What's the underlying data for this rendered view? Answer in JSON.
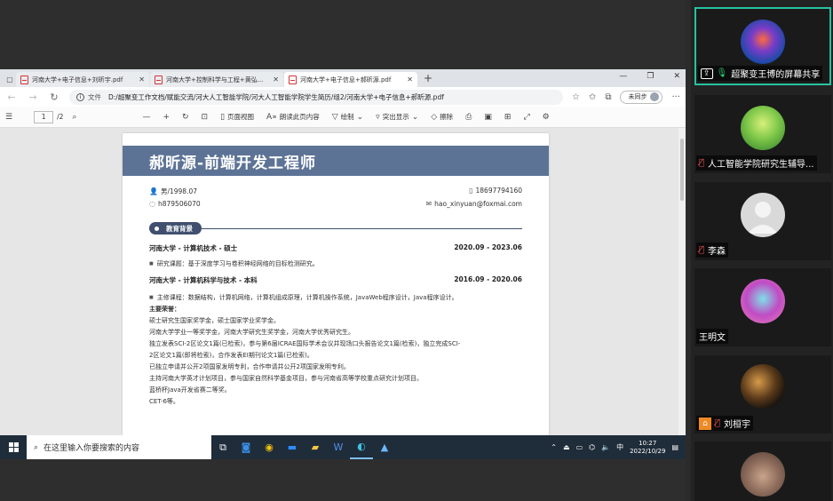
{
  "browser": {
    "tabs": [
      {
        "title": "河南大学+电子信息+刘昕宇.pdf"
      },
      {
        "title": "河南大学+控制科学与工程+黄弘..."
      },
      {
        "title": "河南大学+电子信息+郝昕源.pdf"
      }
    ],
    "new_tab_glyph": "+",
    "address": {
      "label": "文件",
      "path": "D:/超聚变工作文档/赋能交流/河大人工智能学院/河大人工智能学院学生简历/组2/河南大学+电子信息+郝昕源.pdf"
    },
    "sync_label": "未同步"
  },
  "pdf_toolbar": {
    "page_current": "1",
    "page_total": "/2",
    "items": [
      {
        "icon": "page-view-icon",
        "label": "页面视图"
      },
      {
        "icon": "read-aloud-icon",
        "label": "朗读此页内容"
      },
      {
        "icon": "draw-icon",
        "label": "绘制"
      },
      {
        "icon": "highlight-icon",
        "label": "突出显示"
      },
      {
        "icon": "erase-icon",
        "label": "擦除"
      }
    ]
  },
  "resume": {
    "title": "郝昕源-前端开发工程师",
    "gender_birth": "男/1998.07",
    "wechat": "h879506070",
    "phone": "18697794160",
    "email": "hao_xinyuan@foxmai.com",
    "section_education": "教育背景",
    "edu1_school": "河南大学 - 计算机技术 - 硕士",
    "edu1_date": "2020.09 - 2023.06",
    "edu1_topic": "研究课题：基于深度学习与卷积神经网络的目标检测研究。",
    "edu2_school": "河南大学 - 计算机科学与技术 - 本科",
    "edu2_date": "2016.09 - 2020.06",
    "edu2_courses": "主修课程：数据结构，计算机网络，计算机组成原理，计算机操作系统，JavaWeb程序设计，Java程序设计。",
    "honors_title": "主要荣誉：",
    "honors": [
      "硕士研究生国家奖学金，硕士国家学业奖学金。",
      "河南大学学业一等奖学金，河南大学研究生奖学金，河南大学优秀研究生。",
      "独立发表SCI-2区论文1篇(已检索)，参与第6届ICRAE国际学术会议并现场口头报告论文1篇(检索)，独立完成SCI-",
      "2区论文1篇(即将检索)，合作发表EI期刊论文1篇(已检索)。",
      "已独立申请并公开2项国家发明专利，合作申请并公开2项国家发明专利。",
      "主持河南大学英才计划项目，参与国家自然科学基金项目，参与河南省高等学校重点研究计划项目。",
      "蓝桥杯Java开发省赛二等奖。",
      "CET-6等。"
    ]
  },
  "taskbar": {
    "search_placeholder": "在这里输入你要搜索的内容",
    "time": "10:27",
    "date": "2022/10/29",
    "ime": "中"
  },
  "participants": [
    {
      "name": "超聚变王博的屏幕共享",
      "mic": "on",
      "share": true
    },
    {
      "name": "人工智能学院研究生辅导...",
      "mic": "off"
    },
    {
      "name": "李森",
      "mic": "off"
    },
    {
      "name": "王明文",
      "mic": "none"
    },
    {
      "name": "刘桓宇",
      "mic": "off",
      "host": true
    },
    {
      "name": "",
      "mic": "none"
    }
  ],
  "colors": {
    "resume_header": "#5d7396",
    "section_pill": "#3f4f6d",
    "active_speaker_border": "#27c2a0",
    "taskbar": "#1f2c3a"
  }
}
